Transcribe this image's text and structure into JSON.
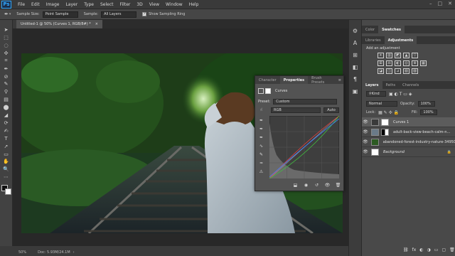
{
  "app": {
    "logo": "Ps"
  },
  "menu": [
    "File",
    "Edit",
    "Image",
    "Layer",
    "Type",
    "Select",
    "Filter",
    "3D",
    "View",
    "Window",
    "Help"
  ],
  "window_controls": [
    "–",
    "□",
    "✕"
  ],
  "options": {
    "sample_size_label": "Sample Size:",
    "sample_size_value": "Point Sample",
    "sample_label": "Sample:",
    "sample_value": "All Layers",
    "show_ring_label": "Show Sampling Ring",
    "show_ring_checked": "✓"
  },
  "document": {
    "tab_title": "Untitled-1 @ 50% (Curves 1, RGB/8#) *",
    "tab_close": "×"
  },
  "status": {
    "zoom": "50%",
    "doc_info": "Doc: 5.93M/24.1M"
  },
  "props_panel": {
    "tabs": [
      "Character",
      "Properties",
      "Brush Presets"
    ],
    "active_tab": "Properties",
    "title": "Curves",
    "preset_label": "Preset:",
    "preset_value": "Custom",
    "channel_value": "RGB",
    "auto_button": "Auto"
  },
  "right_panel": {
    "top_tabs": [
      "Color",
      "Swatches"
    ],
    "mid_tabs": [
      "Libraries",
      "Adjustments"
    ],
    "add_adjustment": "Add an adjustment",
    "adj_row1": [
      "☀",
      "▥",
      "◩",
      "▲",
      "▽",
      "◈",
      ""
    ],
    "adj_row2": [
      "⊞",
      "⚖",
      "◐",
      "◎",
      "⊕",
      "▦",
      ""
    ],
    "adj_row3": [
      "◪",
      "◫",
      "⊿",
      "▧",
      "▨",
      "",
      ""
    ],
    "layer_tabs": [
      "Layers",
      "Paths",
      "Channels"
    ],
    "kind_label": "Kind",
    "blend_mode": "Normal",
    "opacity_label": "Opacity:",
    "opacity_value": "100%",
    "lock_label": "Lock:",
    "fill_label": "Fill:",
    "fill_value": "100%",
    "layers": [
      {
        "name": "Curves 1",
        "type": "adjustment"
      },
      {
        "name": "adult-back-view-beach-calm-n...",
        "type": "masked"
      },
      {
        "name": "abandoned-forest-industry-nature-34950",
        "type": "photo"
      },
      {
        "name": "Background",
        "type": "fill"
      }
    ],
    "layer_footer_icons": [
      "⛓",
      "fx",
      "◐",
      "◑",
      "▭",
      "▢",
      "🗑"
    ]
  },
  "tools": [
    "➤",
    "⬚",
    "◌",
    "✣",
    "⌗",
    "✒",
    "⊘",
    "✎",
    "⚲",
    "▤",
    "⬤",
    "◢",
    "⟳",
    "✍",
    "T",
    "➚",
    "▭",
    "✋",
    "🔍",
    "⋯"
  ],
  "dock_icons": [
    "⚙",
    "A",
    "⊞",
    "◧",
    "¶",
    "▣"
  ]
}
